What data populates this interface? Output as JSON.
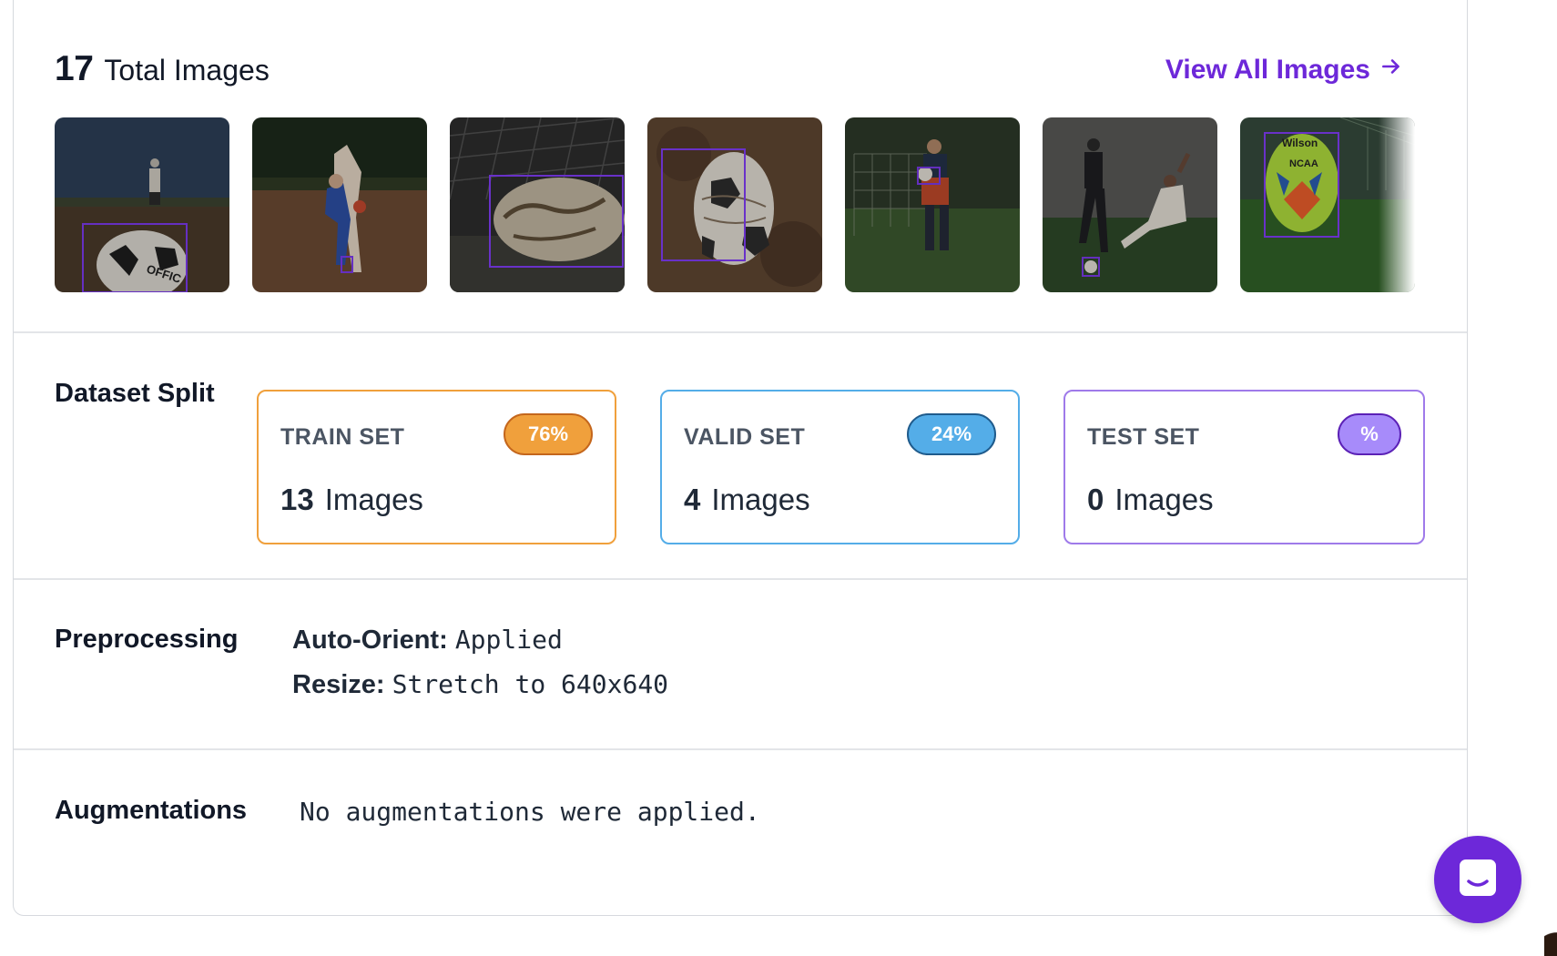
{
  "header": {
    "total_count": "17",
    "total_label": "Total Images",
    "view_all_label": "View All Images",
    "accent": "#6d28d9"
  },
  "thumbnails": [
    {
      "alt": "soccer ball in field"
    },
    {
      "alt": "players in dirt field"
    },
    {
      "alt": "muddy ball close-up"
    },
    {
      "alt": "worn ball on dirt"
    },
    {
      "alt": "coach walking on field"
    },
    {
      "alt": "players sliding tackle"
    },
    {
      "alt": "green NCAA ball on grass"
    }
  ],
  "dataset_split": {
    "label": "Dataset Split",
    "train": {
      "name": "TRAIN SET",
      "percent": "76%",
      "count": "13",
      "unit": "Images",
      "color": "#f0a03c"
    },
    "valid": {
      "name": "VALID SET",
      "percent": "24%",
      "count": "4",
      "unit": "Images",
      "color": "#54ade8"
    },
    "test": {
      "name": "TEST SET",
      "percent": "%",
      "count": "0",
      "unit": "Images",
      "color": "#9f7aea"
    }
  },
  "preprocessing": {
    "label": "Preprocessing",
    "items": [
      {
        "key": "Auto-Orient:",
        "value": "Applied"
      },
      {
        "key": "Resize:",
        "value": "Stretch to 640x640"
      }
    ]
  },
  "augmentations": {
    "label": "Augmentations",
    "text": "No augmentations were applied."
  },
  "chat": {
    "icon": "chat-icon"
  }
}
